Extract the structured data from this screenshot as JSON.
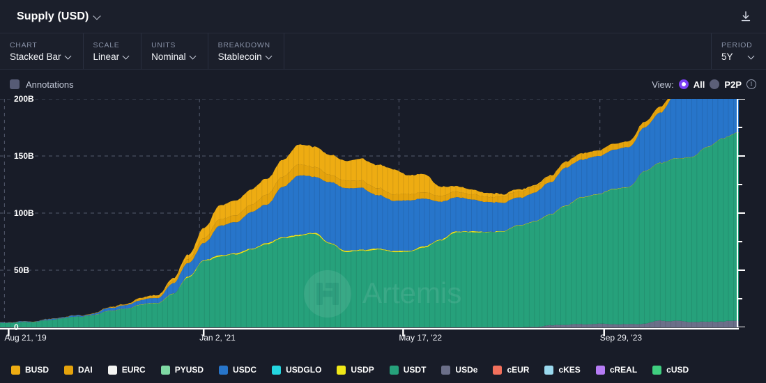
{
  "header": {
    "title": "Supply (USD)",
    "title_chevron_icon": "chevron-down-icon",
    "download_icon": "download-icon"
  },
  "controls": [
    {
      "label": "CHART",
      "value": "Stacked Bar",
      "name": "chart-type"
    },
    {
      "label": "SCALE",
      "value": "Linear",
      "name": "scale"
    },
    {
      "label": "UNITS",
      "value": "Nominal",
      "name": "units"
    },
    {
      "label": "BREAKDOWN",
      "value": "Stablecoin",
      "name": "breakdown"
    }
  ],
  "period": {
    "label": "PERIOD",
    "value": "5Y"
  },
  "annotations": {
    "label": "Annotations",
    "checked": false
  },
  "view": {
    "label": "View:",
    "options": [
      {
        "label": "All",
        "selected": true
      },
      {
        "label": "P2P",
        "selected": false
      }
    ],
    "accent": "#7b3ff2",
    "info_icon": "info-icon"
  },
  "watermark": {
    "text": "Artemis",
    "logo_icon": "artemis-logo-icon"
  },
  "legend": [
    {
      "label": "BUSD",
      "color": "#eeac12"
    },
    {
      "label": "DAI",
      "color": "#e5a30c"
    },
    {
      "label": "EURC",
      "color": "#f3f4f2"
    },
    {
      "label": "PYUSD",
      "color": "#7fd9a4"
    },
    {
      "label": "USDC",
      "color": "#2775ca"
    },
    {
      "label": "USDGLO",
      "color": "#24d6e0"
    },
    {
      "label": "USDP",
      "color": "#f0e818"
    },
    {
      "label": "USDT",
      "color": "#26a17b"
    },
    {
      "label": "USDe",
      "color": "#6b6f89"
    },
    {
      "label": "cEUR",
      "color": "#f2705c"
    },
    {
      "label": "cKES",
      "color": "#9ad9ee"
    },
    {
      "label": "cREAL",
      "color": "#b67cf5"
    },
    {
      "label": "cUSD",
      "color": "#3fce7f"
    }
  ],
  "chart_data": {
    "type": "area",
    "stacked": true,
    "title": "Supply (USD)",
    "xlabel": "",
    "ylabel": "",
    "ylim": [
      0,
      200
    ],
    "ytick_values": [
      0,
      50,
      100,
      150,
      200
    ],
    "ytick_labels": [
      "0",
      "50B",
      "100B",
      "150B",
      "200B"
    ],
    "yunit": "B",
    "grid": true,
    "grid_style": "dashed",
    "legend_position": "bottom",
    "xtick_labels": [
      "Aug 21, '19",
      "Jan 2, '21",
      "May 17, '22",
      "Sep 29, '23"
    ],
    "xtick_positions_pct": [
      0.6,
      27.0,
      54.0,
      81.2
    ],
    "x": [
      "2019-08-21",
      "2019-11-01",
      "2020-01-15",
      "2020-03-15",
      "2020-05-01",
      "2020-06-15",
      "2020-08-01",
      "2020-09-15",
      "2020-11-01",
      "2020-12-15",
      "2021-01-02",
      "2021-02-15",
      "2021-04-01",
      "2021-05-15",
      "2021-07-01",
      "2021-08-15",
      "2021-10-01",
      "2021-11-15",
      "2022-01-01",
      "2022-02-15",
      "2022-04-01",
      "2022-05-17",
      "2022-06-15",
      "2022-08-01",
      "2022-09-15",
      "2022-11-01",
      "2022-12-15",
      "2023-02-01",
      "2023-03-15",
      "2023-05-01",
      "2023-06-15",
      "2023-08-01",
      "2023-09-29",
      "2023-11-15",
      "2024-01-01",
      "2024-02-15",
      "2024-04-01",
      "2024-05-15",
      "2024-07-01",
      "2024-08-15",
      "2024-10-01",
      "2024-11-15",
      "2025-01-01",
      "2025-02-15",
      "2025-04-01",
      "2025-05-15",
      "2025-07-01",
      "2025-08-10"
    ],
    "series": [
      {
        "name": "USDT",
        "color": "#26a17b",
        "values": [
          3.8,
          4.1,
          4.6,
          5.8,
          8.0,
          9.2,
          10.5,
          14.5,
          16.0,
          20.0,
          21.0,
          29.0,
          44.0,
          58.0,
          62.0,
          64.0,
          68.0,
          73.0,
          78.0,
          80.0,
          82.0,
          73.0,
          66.0,
          67.0,
          68.0,
          66.0,
          66.0,
          70.0,
          76.0,
          83.0,
          83.5,
          83.0,
          84.0,
          89.0,
          92.0,
          97.0,
          104.0,
          111.0,
          113.0,
          118.0,
          120.0,
          133.0,
          138.0,
          142.0,
          144.0,
          153.0,
          160.0,
          165.0
        ]
      },
      {
        "name": "USDP",
        "color": "#f0e818",
        "values": [
          0.1,
          0.1,
          0.1,
          0.1,
          0.1,
          0.1,
          0.2,
          0.2,
          0.2,
          0.3,
          0.3,
          0.4,
          0.6,
          0.9,
          1.0,
          1.0,
          0.9,
          0.9,
          0.9,
          0.9,
          0.9,
          0.9,
          0.9,
          0.9,
          0.9,
          0.9,
          0.9,
          0.9,
          0.9,
          0.9,
          0.6,
          0.5,
          0.4,
          0.4,
          0.4,
          0.4,
          0.4,
          0.4,
          0.4,
          0.4,
          0.3,
          0.3,
          0.3,
          0.3,
          0.3,
          0.3,
          0.3,
          0.3
        ]
      },
      {
        "name": "USDC",
        "color": "#2775ca",
        "values": [
          0.4,
          0.5,
          0.5,
          0.7,
          0.9,
          1.0,
          1.2,
          2.6,
          2.8,
          4.0,
          4.1,
          9.0,
          12.0,
          15.0,
          26.0,
          27.0,
          32.0,
          34.0,
          44.0,
          52.0,
          49.0,
          53.0,
          55.0,
          54.0,
          47.0,
          44.0,
          44.0,
          42.0,
          33.0,
          30.0,
          28.0,
          26.0,
          25.0,
          24.0,
          25.0,
          28.0,
          33.0,
          33.0,
          33.0,
          34.0,
          35.0,
          38.0,
          44.0,
          56.0,
          60.0,
          61.0,
          64.0,
          65.0
        ]
      },
      {
        "name": "DAI",
        "color": "#e5a30c",
        "values": [
          0.1,
          0.1,
          0.1,
          0.1,
          0.1,
          0.1,
          0.3,
          0.5,
          0.7,
          1.1,
          1.2,
          2.0,
          3.3,
          4.4,
          5.4,
          6.2,
          6.5,
          8.5,
          9.2,
          9.5,
          8.6,
          6.5,
          6.3,
          6.5,
          6.0,
          5.6,
          5.5,
          5.4,
          5.2,
          4.8,
          4.6,
          4.5,
          5.3,
          5.4,
          5.3,
          5.0,
          5.2,
          5.3,
          5.3,
          5.3,
          5.2,
          5.0,
          5.0,
          5.0,
          4.5,
          4.5,
          5.3,
          5.5
        ]
      },
      {
        "name": "BUSD",
        "color": "#eeac12",
        "values": [
          0.0,
          0.0,
          0.0,
          0.1,
          0.1,
          0.1,
          0.1,
          0.1,
          0.3,
          1.0,
          1.2,
          2.5,
          4.0,
          9.0,
          12.5,
          12.8,
          13.5,
          14.0,
          14.5,
          17.5,
          17.8,
          17.5,
          17.5,
          19.0,
          20.5,
          22.0,
          16.5,
          16.0,
          8.0,
          5.0,
          4.0,
          3.5,
          2.3,
          1.8,
          1.2,
          0.8,
          0.3,
          0.1,
          0.0,
          0.0,
          0.0,
          0.0,
          0.0,
          0.0,
          0.0,
          0.0,
          0.0,
          0.0
        ]
      },
      {
        "name": "USDe",
        "color": "#6b6f89",
        "values": [
          0.0,
          0.0,
          0.0,
          0.0,
          0.0,
          0.0,
          0.0,
          0.0,
          0.0,
          0.0,
          0.0,
          0.0,
          0.0,
          0.0,
          0.0,
          0.0,
          0.0,
          0.0,
          0.0,
          0.0,
          0.0,
          0.0,
          0.0,
          0.0,
          0.0,
          0.0,
          0.0,
          0.0,
          0.0,
          0.0,
          0.0,
          0.0,
          0.0,
          0.0,
          0.3,
          1.5,
          2.3,
          2.6,
          3.0,
          2.8,
          2.6,
          3.2,
          5.8,
          5.5,
          4.8,
          4.7,
          5.2,
          5.6
        ]
      }
    ]
  }
}
